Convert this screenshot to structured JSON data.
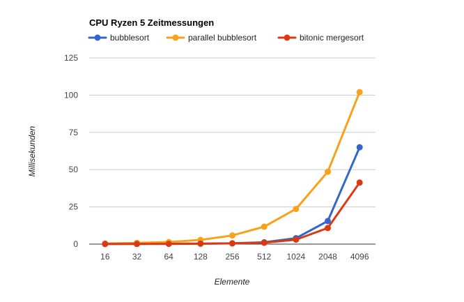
{
  "chart_data": {
    "type": "line",
    "title": "CPU Ryzen 5 Zeitmessungen",
    "xlabel": "Elemente",
    "ylabel": "Millisekunden",
    "categories": [
      "16",
      "32",
      "64",
      "128",
      "256",
      "512",
      "1024",
      "2048",
      "4096"
    ],
    "ylim": [
      0,
      125
    ],
    "yticks": [
      0,
      25,
      50,
      75,
      100,
      125
    ],
    "grid": true,
    "legend": "top-left",
    "series": [
      {
        "name": "bubblesort",
        "color": "#3366cc",
        "values": [
          0.1,
          0.2,
          0.3,
          0.3,
          0.5,
          1.2,
          4.0,
          15.5,
          65.0
        ]
      },
      {
        "name": "parallel bubblesort",
        "color": "#f6a21d",
        "values": [
          0.4,
          0.8,
          1.4,
          2.8,
          5.8,
          11.7,
          23.6,
          48.6,
          102.0
        ]
      },
      {
        "name": "bitonic mergesort",
        "color": "#dc3912",
        "values": [
          0.1,
          0.1,
          0.2,
          0.3,
          0.5,
          0.9,
          3.0,
          10.8,
          41.3
        ]
      }
    ]
  }
}
